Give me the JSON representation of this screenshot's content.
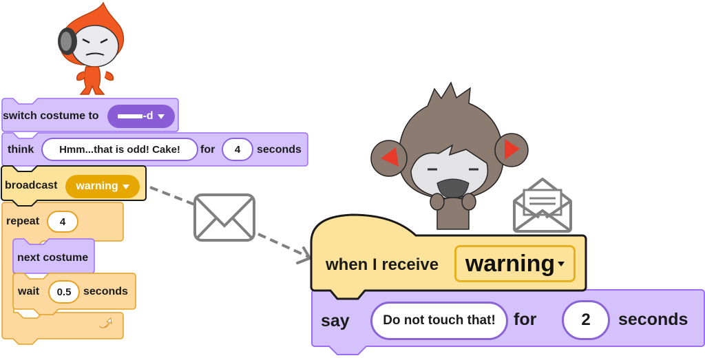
{
  "colors": {
    "looks_fill": "#d5c2fc",
    "looks_stroke": "#9b6ef3",
    "looks_dropdown": "#8a5cd6",
    "events_fill": "#fde39a",
    "events_dropdown": "#e6a800",
    "control_fill": "#fdd9a0",
    "control_stroke": "#e4a126",
    "arrow_gray": "#808080"
  },
  "script_left": {
    "switch_costume": {
      "label": "switch costume to",
      "value": "-d"
    },
    "think": {
      "label": "think",
      "message": "Hmm...that is odd! Cake!",
      "for_label": "for",
      "secs": "4",
      "seconds_label": "seconds"
    },
    "broadcast": {
      "label": "broadcast",
      "message": "warning"
    },
    "repeat": {
      "label": "repeat",
      "count": "4"
    },
    "next_costume": {
      "label": "next costume"
    },
    "wait": {
      "label": "wait",
      "secs": "0.5",
      "seconds_label": "seconds"
    }
  },
  "script_right": {
    "when_receive": {
      "label": "when I receive",
      "message": "warning"
    },
    "say": {
      "label": "say",
      "message": "Do not touch that!",
      "for_label": "for",
      "secs": "2",
      "seconds_label": "seconds"
    }
  },
  "icons": {
    "envelope_closed": "envelope-icon",
    "envelope_open": "open-envelope-icon",
    "loop_arrow": "loop-arrow-icon"
  }
}
